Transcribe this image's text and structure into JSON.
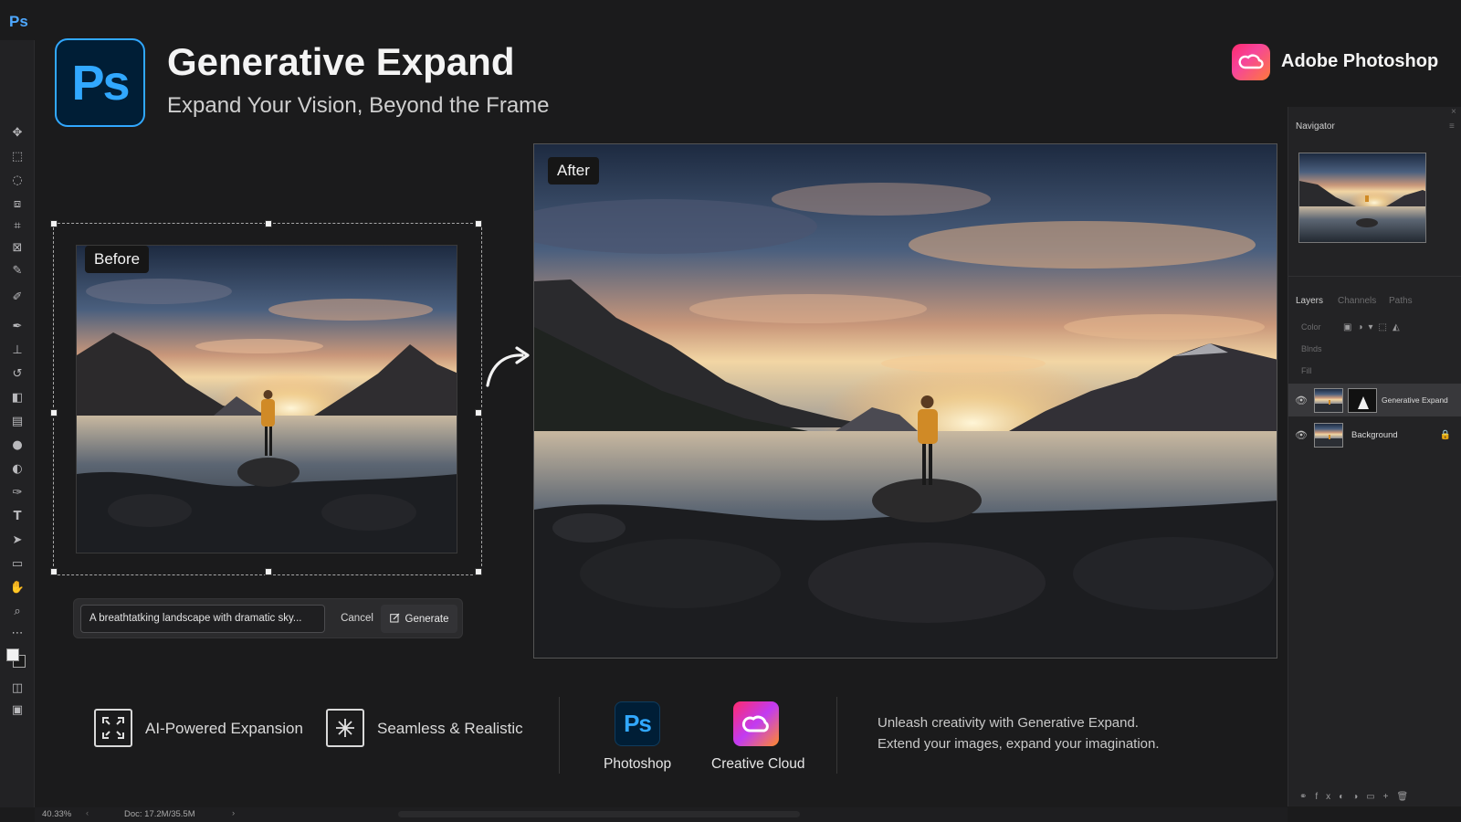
{
  "app": {
    "mini_icon": "Ps"
  },
  "header": {
    "logo_text": "Ps",
    "title": "Generative Expand",
    "subtitle": "Expand Your Vision, Beyond the Frame",
    "brand_name": "Adobe Photoshop",
    "brand_icon": "creative-cloud-icon"
  },
  "toolbar": {
    "tools": [
      "move-icon",
      "marquee-icon",
      "lasso-icon",
      "object-select-icon",
      "crop-icon",
      "frame-icon",
      "eyedropper-icon",
      "healing-brush-icon",
      "brush-icon",
      "clone-stamp-icon",
      "history-brush-icon",
      "eraser-icon",
      "gradient-icon",
      "blur-icon",
      "dodge-icon",
      "pen-icon",
      "type-icon",
      "path-select-icon",
      "rectangle-icon",
      "hand-icon",
      "zoom-icon",
      "more-icon"
    ]
  },
  "before": {
    "label": "Before"
  },
  "after": {
    "label": "After"
  },
  "prompt": {
    "value": "A breathtatking landscape with dramatic sky...",
    "cancel_label": "Cancel",
    "generate_label": "Generate"
  },
  "panel": {
    "navigator_title": "Navigator",
    "tabs": [
      "Layers",
      "Channels",
      "Paths"
    ],
    "row_labels": [
      "Color",
      "Blnds",
      "Fill"
    ],
    "layers": [
      {
        "name": "Generative Expand"
      },
      {
        "name": "Background"
      }
    ]
  },
  "features": [
    {
      "label": "AI-Powered Expansion",
      "icon": "expand-icon"
    },
    {
      "label": "Seamless & Realistic",
      "icon": "sparkle-icon"
    }
  ],
  "apps": [
    {
      "label": "Photoshop",
      "tile_text": "Ps",
      "color": "#001e36",
      "accent": "#31a8ff"
    },
    {
      "label": "Creative Cloud",
      "icon": "creative-cloud-icon",
      "color": "#ff2a6d"
    }
  ],
  "tagline": {
    "line1": "Unleash creativity with Generative Expand.",
    "line2": "Extend your images, expand your imagination."
  },
  "status": {
    "zoom": "40.33%",
    "doc": "Doc: 17.2M/35.5M"
  }
}
